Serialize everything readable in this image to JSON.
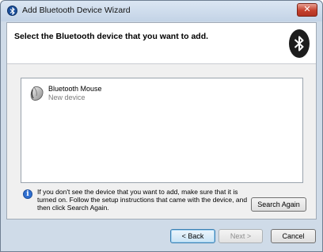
{
  "window": {
    "title": "Add Bluetooth Device Wizard",
    "close_label": "✕"
  },
  "header": {
    "heading": "Select the Bluetooth device that you want to add."
  },
  "devices": [
    {
      "name": "Bluetooth Mouse",
      "status": "New device",
      "icon": "mouse-icon"
    }
  ],
  "info": {
    "icon": "info-icon",
    "icon_glyph": "i",
    "text": "If you don't see the device that you want to add, make sure that it is turned on. Follow the setup instructions that came with the device, and then click Search Again."
  },
  "buttons": {
    "search_again": "Search Again",
    "back": "< Back",
    "next": "Next >",
    "cancel": "Cancel"
  },
  "colors": {
    "window_frame": "#cfdbe8",
    "close_button": "#c4402c",
    "bluetooth_logo": "#1d1d1d",
    "default_button_border": "#3c7fb1"
  }
}
